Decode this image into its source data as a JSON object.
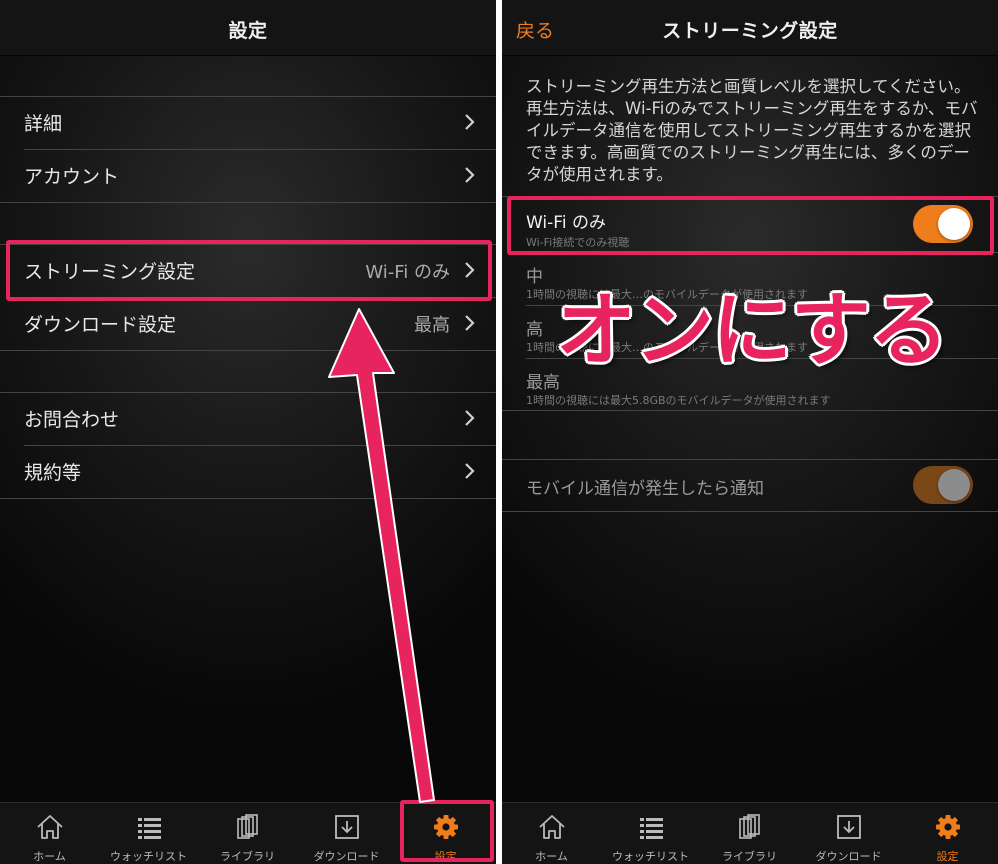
{
  "left": {
    "title": "設定",
    "rows": [
      {
        "label": "詳細",
        "value": ""
      },
      {
        "label": "アカウント",
        "value": ""
      },
      {
        "label": "ストリーミング設定",
        "value": "Wi-Fi のみ"
      },
      {
        "label": "ダウンロード設定",
        "value": "最高"
      },
      {
        "label": "お問合わせ",
        "value": ""
      },
      {
        "label": "規約等",
        "value": ""
      }
    ]
  },
  "right": {
    "back": "戻る",
    "title": "ストリーミング設定",
    "description": "ストリーミング再生方法と画質レベルを選択してください。再生方法は、Wi-Fiのみでストリーミング再生をするか、モバイルデータ通信を使用してストリーミング再生するかを選択できます。高画質でのストリーミング再生には、多くのデータが使用されます。",
    "wifi": {
      "title": "Wi-Fi のみ",
      "subtitle": "Wi-Fi接続でのみ視聴",
      "enabled": true
    },
    "qualities": [
      {
        "title": "中",
        "subtitle": "1時間の視聴には最大…のモバイルデータが使用されます"
      },
      {
        "title": "高",
        "subtitle": "1時間の視聴には最大…のモバイルデータが使用されます"
      },
      {
        "title": "最高",
        "subtitle": "1時間の視聴には最大5.8GBのモバイルデータが使用されます"
      }
    ],
    "notify": {
      "label": "モバイル通信が発生したら通知",
      "enabled": true
    }
  },
  "tabs": [
    {
      "label": "ホーム",
      "icon": "home-icon"
    },
    {
      "label": "ウォッチリスト",
      "icon": "list-icon"
    },
    {
      "label": "ライブラリ",
      "icon": "library-icon"
    },
    {
      "label": "ダウンロード",
      "icon": "download-icon"
    },
    {
      "label": "設定",
      "icon": "gear-icon",
      "active": true
    }
  ],
  "annotation": {
    "callout": "オンにする"
  },
  "colors": {
    "accent": "#f07d1b",
    "highlight": "#e8245f"
  }
}
